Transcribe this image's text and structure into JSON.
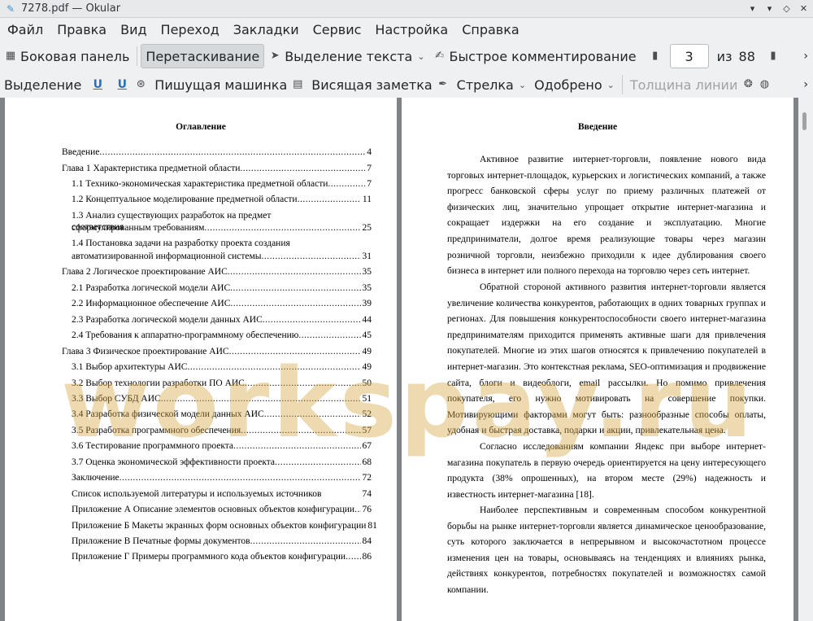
{
  "window": {
    "title": "7278.pdf  — Okular"
  },
  "menu": [
    "Файл",
    "Правка",
    "Вид",
    "Переход",
    "Закладки",
    "Сервис",
    "Настройка",
    "Справка"
  ],
  "toolbar1": {
    "sidebar": "Боковая панель",
    "drag": "Перетаскивание",
    "text_select": "Выделение текста",
    "quick_comment": "Быстрое комментирование",
    "page_current": "3",
    "page_of": "из",
    "page_total": "88"
  },
  "toolbar2": {
    "selection": "Выделение",
    "typewriter": "Пишущая машинка",
    "sticky_note": "Висящая заметка",
    "arrow": "Стрелка",
    "approved": "Одобрено",
    "line_width": "Толщина линии"
  },
  "left_page": {
    "title": "Оглавление",
    "toc": [
      {
        "label": "Введение",
        "page": "4"
      },
      {
        "label": "Глава 1 Характеристика предметной области",
        "page": "7"
      },
      {
        "label": "1.1 Технико-экономическая характеристика предметной области",
        "page": "7"
      },
      {
        "label": "1.2 Концептуальное моделирование предметной области",
        "page": "11"
      },
      {
        "label1": "1.3 Анализ существующих разработок на предмет соответствия",
        "label": "сформулированным требованиям",
        "page": "25"
      },
      {
        "label1": "1.4 Постановка задачи на разработку проекта создания",
        "label": "автоматизированной информационной системы",
        "page": "31"
      },
      {
        "label": "Глава 2 Логическое проектирование АИС",
        "page": "35"
      },
      {
        "label": "2.1 Разработка логической модели АИС",
        "page": "35"
      },
      {
        "label": "2.2 Информационное обеспечение АИС",
        "page": "39"
      },
      {
        "label": "2.3 Разработка логической модели данных АИС",
        "page": "44"
      },
      {
        "label": "2.4 Требования к аппаратно-программному обеспечению",
        "page": "45"
      },
      {
        "label": "Глава 3 Физическое проектирование АИС",
        "page": "49"
      },
      {
        "label": "3.1 Выбор архитектуры АИС",
        "page": "49"
      },
      {
        "label": "3.2 Выбор технологии разработки ПО АИС",
        "page": "50"
      },
      {
        "label": "3.3 Выбор СУБД АИС",
        "page": "51"
      },
      {
        "label": "3.4 Разработка физической модели данных АИС",
        "page": "52"
      },
      {
        "label": "3.5 Разработка программного обеспечения",
        "page": "57"
      },
      {
        "label": "3.6 Тестирование программного проекта",
        "page": "67"
      },
      {
        "label": "3.7 Оценка экономической эффективности проекта",
        "page": "68"
      },
      {
        "label": "Заключение",
        "page": "72"
      },
      {
        "label": "Список используемой литературы и используемых источников",
        "page": "74"
      },
      {
        "label": "Приложение А Описание элементов основных объектов конфигурации",
        "page": "76"
      },
      {
        "label": "Приложение Б Макеты экранных форм основных объектов конфигурации",
        "page": "81"
      },
      {
        "label": "Приложение В Печатные формы документов",
        "page": "84"
      },
      {
        "label": "Приложение Г Примеры программного кода объектов конфигурации",
        "page": "86"
      }
    ]
  },
  "right_page": {
    "title": "Введение",
    "paragraphs": [
      "Активное развитие интернет-торговли, появление нового вида торговых интернет-площадок, курьерских и логистических компаний, а также прогресс банковской сферы услуг по приему различных платежей от физических лиц, значительно упрощает открытие интернет-магазина и сокращает издержки на его создание и эксплуатацию. Многие предприниматели, долгое время реализующие товары через магазин розничной торговли, неизбежно приходили к идее дублирования своего бизнеса в интернет или полного перехода на торговлю через сеть интернет.",
      "Обратной стороной активного развития интернет-торговли является увеличение количества конкурентов, работающих в одних товарных группах и регионах. Для повышения конкурентоспособности своего интернет-магазина предпринимателям приходится применять активные шаги для привлечения покупателей. Многие из этих шагов относятся к привлечению покупателей в интернет-магазин. Это контекстная реклама, SEO-оптимизация и продвижение сайта, блоги и видеоблоги, email рассылки. Но помимо привлечения покупателя, его нужно мотивировать на совершение покупки. Мотивирующими факторами могут быть: разнообразные способы оплаты, удобная и быстрая доставка, подарки и акции, привлекательная цена.",
      "Согласно исследованиям компании Яндекс при выборе интернет-магазина покупатель в первую очередь ориентируется на цену интересующего продукта (38% опрошенных), на втором месте (29%) надежность и известность интернет-магазина [18].",
      "Наиболее перспективным и современным способом конкурентной борьбы на рынке интернет-торговли является динамическое ценообразование, суть которого заключается в непрерывном и высокочастотном процессе изменения цен на товары, основываясь на тенденциях и влияниях рынка, действиях конкурентов, потребностях покупателей и возможностях самой компании."
    ]
  },
  "watermark": "workspay.ru"
}
